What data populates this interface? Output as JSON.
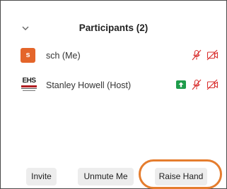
{
  "header": {
    "title": "Participants (2)",
    "collapse_icon": "chevron-down-icon"
  },
  "participants": [
    {
      "name": "sch (Me)",
      "avatar_letter": "s",
      "avatar_color": "#e4652a",
      "mic": "muted",
      "video": "off"
    },
    {
      "name": "Stanley Howell (Host)",
      "avatar_logo_text": "EHS",
      "sharing": true,
      "mic": "muted",
      "video": "off"
    }
  ],
  "footer": {
    "invite_label": "Invite",
    "unmute_label": "Unmute Me",
    "raise_hand_label": "Raise Hand"
  },
  "colors": {
    "muted_red": "#d9302f",
    "share_green": "#1e9c4b",
    "annotation_orange": "#e57d2e"
  }
}
